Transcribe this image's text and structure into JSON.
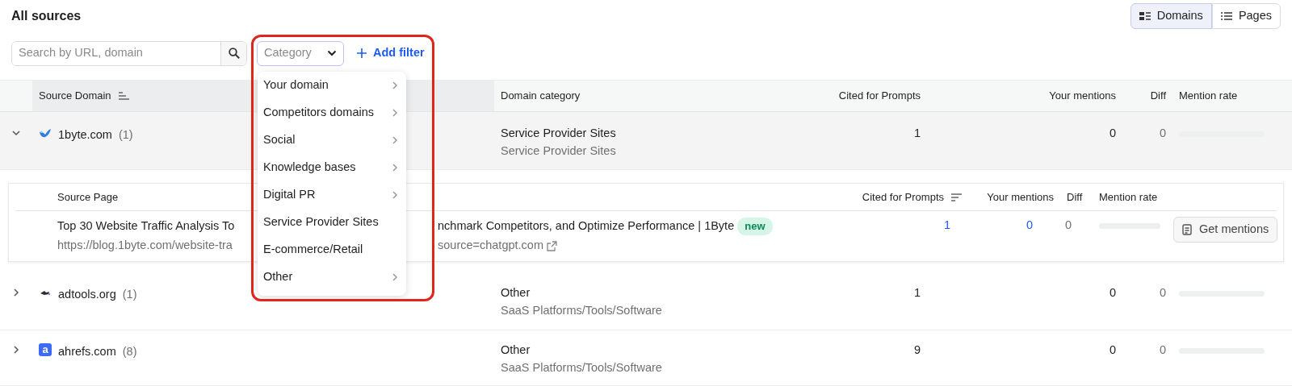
{
  "title": "All sources",
  "view_toggle": [
    {
      "label": "Domains",
      "selected": true
    },
    {
      "label": "Pages",
      "selected": false
    }
  ],
  "search": {
    "placeholder": "Search by URL, domain"
  },
  "category_filter": {
    "placeholder": "Category"
  },
  "add_filter": {
    "label": "Add filter"
  },
  "category_menu": {
    "items": [
      {
        "label": "Your domain",
        "has_submenu": true
      },
      {
        "label": "Competitors domains",
        "has_submenu": true
      },
      {
        "label": "Social",
        "has_submenu": true
      },
      {
        "label": "Knowledge bases",
        "has_submenu": true
      },
      {
        "label": "Digital PR",
        "has_submenu": true
      },
      {
        "label": "Service Provider Sites",
        "has_submenu": false
      },
      {
        "label": "E-commerce/Retail",
        "has_submenu": false
      },
      {
        "label": "Other",
        "has_submenu": true
      }
    ]
  },
  "table": {
    "columns": [
      "Source Domain",
      "Domain category",
      "Cited for Prompts",
      "Your mentions",
      "Diff",
      "Mention rate"
    ],
    "rows": [
      {
        "domain": "1byte.com",
        "count": "(1)",
        "favicon": {
          "kind": "bird"
        },
        "expanded": true,
        "category": "Service Provider Sites",
        "subcategory": "Service Provider Sites",
        "cited": "1",
        "mentions": "0",
        "diff": "0",
        "level": 0,
        "pages": {
          "columns": [
            "Source Page",
            "Cited for Prompts",
            "Your mentions",
            "Diff",
            "Mention rate"
          ],
          "rows": [
            {
              "title_start": "Top 30 Website Traffic Analysis To",
              "title_end": "nchmark Competitors, and Optimize Performance | 1Byte",
              "badge": "new",
              "url_start": "https://blog.1byte.com/website-tra",
              "url_end": "source=chatgpt.com",
              "cited": "1",
              "mentions": "0",
              "diff": "0",
              "level": 0,
              "button": "Get mentions"
            }
          ]
        }
      },
      {
        "domain": "adtools.org",
        "count": "(1)",
        "favicon": {
          "kind": "dark"
        },
        "expanded": false,
        "category": "Other",
        "subcategory": "SaaS Platforms/Tools/Software",
        "cited": "1",
        "mentions": "0",
        "diff": "0",
        "level": 0
      },
      {
        "domain": "ahrefs.com",
        "count": "(8)",
        "favicon": {
          "kind": "letter",
          "text": "a"
        },
        "expanded": false,
        "category": "Other",
        "subcategory": "SaaS Platforms/Tools/Software",
        "cited": "9",
        "mentions": "0",
        "diff": "0",
        "level": 0
      }
    ]
  }
}
